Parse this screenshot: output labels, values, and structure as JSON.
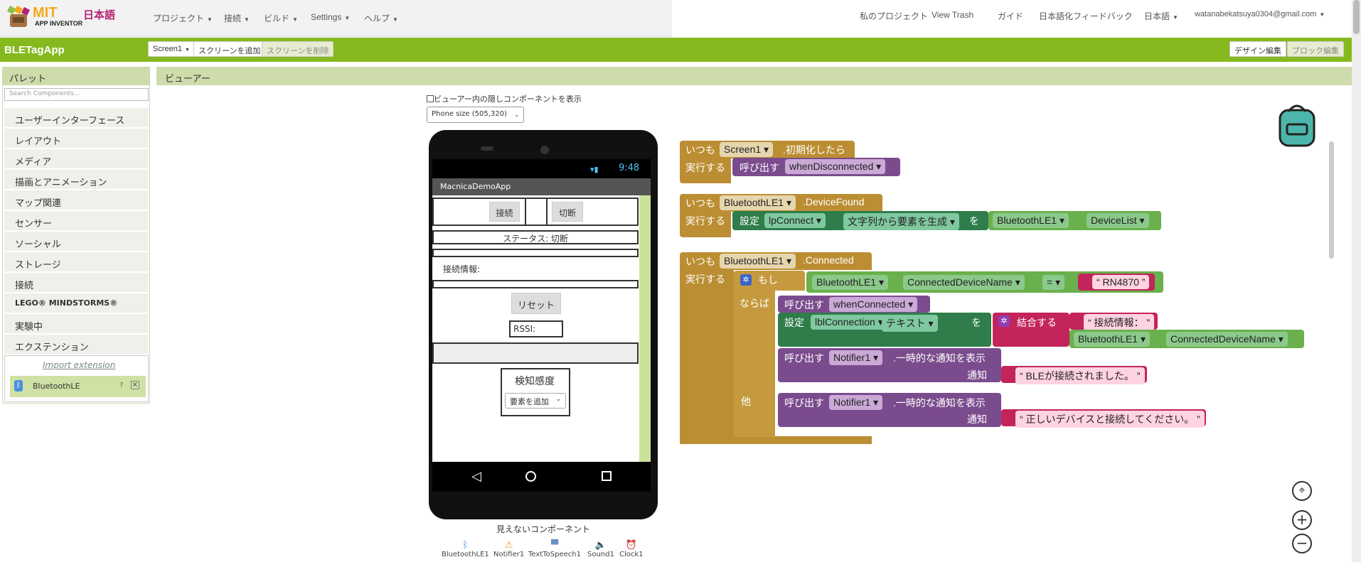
{
  "header": {
    "logo_mit": "MIT",
    "logo_ai": "APP INVENTOR",
    "logo_lang": "日本語",
    "menus": [
      "プロジェクト",
      "接続",
      "ビルド",
      "Settings",
      "ヘルプ"
    ],
    "right_links": [
      "私のプロジェクト",
      "View Trash",
      "ガイド",
      "日本語化フィードバック",
      "日本語",
      "watanabekatsuya0304@gmail.com"
    ]
  },
  "toolbar": {
    "app_name": "BLETagApp",
    "screen_select": "Screen1",
    "add_screen": "スクリーンを追加",
    "remove_screen": "スクリーンを削除",
    "designer": "デザイン編集",
    "blocks": "ブロック編集"
  },
  "palette": {
    "title": "パレット",
    "search_placeholder": "Search Components...",
    "categories": [
      "ユーザーインターフェース",
      "レイアウト",
      "メディア",
      "描画とアニメーション",
      "マップ関連",
      "センサー",
      "ソーシャル",
      "ストレージ",
      "接続",
      "LEGO® MINDSTORMS®",
      "実験中",
      "エクステンション"
    ],
    "import_extension": "Import extension",
    "extension_item": "BluetoothLE"
  },
  "viewer": {
    "title": "ビューアー",
    "hidden_checkbox_label": "ビューアー内の隠しコンポーネントを表示",
    "phone_size": "Phone size (505,320)",
    "time": "9:48",
    "app_title": "MacnicaDemoApp",
    "btn_connect": "接続",
    "btn_disconnect": "切断",
    "status": "ステータス: 切断",
    "conn_info": "接続情報:",
    "btn_reset": "リセット",
    "rssi": "RSSI:",
    "detect_label": "検知感度",
    "add_element": "要素を追加",
    "nonvisible_title": "見えないコンポーネント",
    "nonvisible": [
      "BluetoothLE1",
      "Notifier1",
      "TextToSpeech1",
      "Sound1",
      "Clock1"
    ]
  },
  "blocks": {
    "b1": {
      "when": "いつも",
      "comp": "Screen1",
      "event": ".初期化したら",
      "do": "実行する",
      "call": "呼び出す",
      "proc": "whenDisconnected"
    },
    "b2": {
      "when": "いつも",
      "comp": "BluetoothLE1",
      "event": ".DeviceFound",
      "do": "実行する",
      "set": "設定",
      "target": "lpConnect",
      "prop": "文字列から要素を生成",
      "to": "を",
      "src": "BluetoothLE1",
      "src_prop": "DeviceList"
    },
    "b3": {
      "when": "いつも",
      "comp": "BluetoothLE1",
      "event": ".Connected",
      "do": "実行する",
      "if": "もし",
      "cond_comp": "BluetoothLE1",
      "cond_prop": "ConnectedDeviceName",
      "op": "=",
      "cond_val": "RN4870",
      "then": "ならば",
      "call": "呼び出す",
      "proc": "whenConnected",
      "set": "設定",
      "target": "lblConnection",
      "prop": "テキスト",
      "to": "を",
      "join": "結合する",
      "join_str": "接続情報：",
      "join_comp": "BluetoothLE1",
      "join_prop": "ConnectedDeviceName",
      "notifier": "Notifier1",
      "alert": ".一時的な通知を表示",
      "notice": "通知",
      "msg_ok": "BLEが接続されました。",
      "else": "他",
      "msg_ng": "正しいデバイスと接続してください。"
    }
  }
}
